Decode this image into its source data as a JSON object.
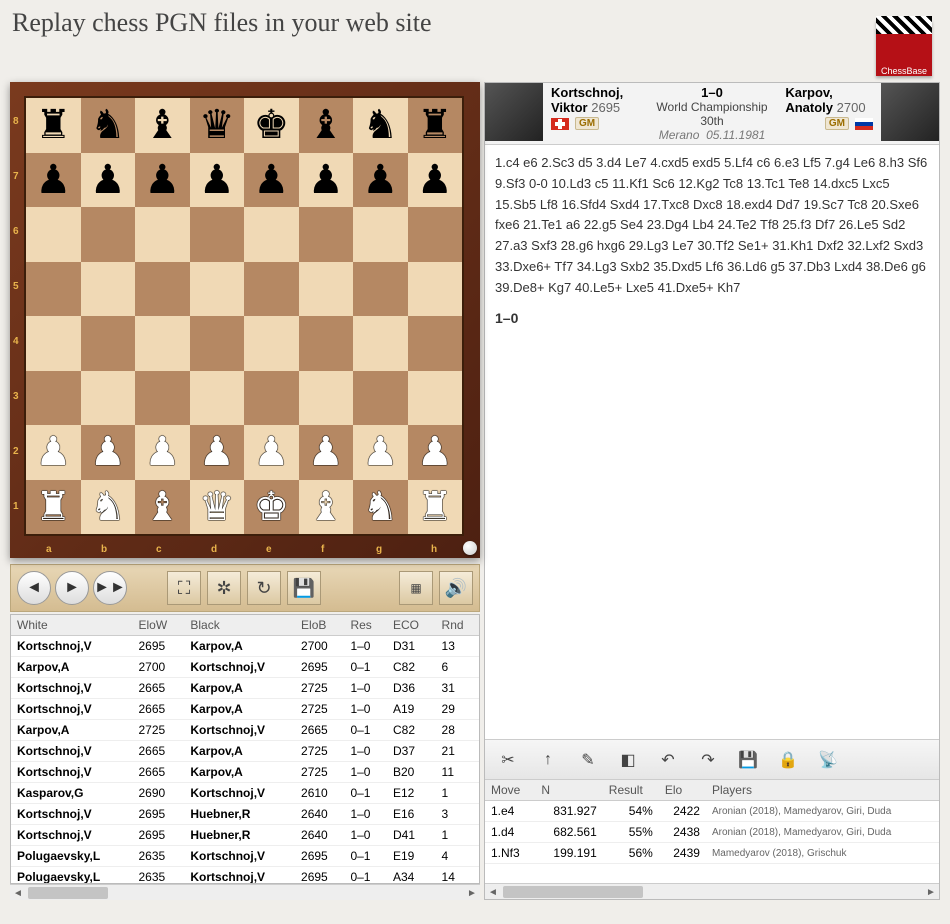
{
  "title": "Replay chess PGN files in your web site",
  "logo_label": "ChessBase",
  "header": {
    "white": {
      "name": "Kortschnoj, Viktor",
      "elo": "2695",
      "title": "GM",
      "flag": "ch"
    },
    "black": {
      "name": "Karpov, Anatoly",
      "elo": "2700",
      "title": "GM",
      "flag": "ru"
    },
    "result": "1–0",
    "event": "World Championship 30th",
    "location": "Merano",
    "date": "05.11.1981"
  },
  "notation": "1.c4 e6 2.Sc3 d5 3.d4 Le7 4.cxd5 exd5 5.Lf4 c6 6.e3 Lf5 7.g4 Le6 8.h3 Sf6 9.Sf3 0-0 10.Ld3 c5 11.Kf1 Sc6 12.Kg2 Tc8 13.Tc1 Te8 14.dxc5 Lxc5 15.Sb5 Lf8 16.Sfd4 Sxd4 17.Txc8 Dxc8 18.exd4 Dd7 19.Sc7 Tc8 20.Sxe6 fxe6 21.Te1 a6 22.g5 Se4 23.Dg4 Lb4 24.Te2 Tf8 25.f3 Df7 26.Le5 Sd2 27.a3 Sxf3 28.g6 hxg6 29.Lg3 Le7 30.Tf2 Se1+ 31.Kh1 Dxf2 32.Lxf2 Sxd3 33.Dxe6+ Tf7 34.Lg3 Sxb2 35.Dxd5 Lf6 36.Ld6 g5 37.Db3 Lxd4 38.De6 g6 39.De8+ Kg7 40.Le5+ Lxe5 41.Dxe5+ Kh7",
  "result_line": "1–0",
  "board": {
    "ranks": [
      "8",
      "7",
      "6",
      "5",
      "4",
      "3",
      "2",
      "1"
    ],
    "files": [
      "a",
      "b",
      "c",
      "d",
      "e",
      "f",
      "g",
      "h"
    ],
    "pieces": [
      [
        "br",
        "bn",
        "bb",
        "bq",
        "bk",
        "bb",
        "bn",
        "br"
      ],
      [
        "bp",
        "bp",
        "bp",
        "bp",
        "bp",
        "bp",
        "bp",
        "bp"
      ],
      [
        "",
        "",
        "",
        "",
        "",
        "",
        "",
        ""
      ],
      [
        "",
        "",
        "",
        "",
        "",
        "",
        "",
        ""
      ],
      [
        "",
        "",
        "",
        "",
        "",
        "",
        "",
        ""
      ],
      [
        "",
        "",
        "",
        "",
        "",
        "",
        "",
        ""
      ],
      [
        "wp",
        "wp",
        "wp",
        "wp",
        "wp",
        "wp",
        "wp",
        "wp"
      ],
      [
        "wr",
        "wn",
        "wb",
        "wq",
        "wk",
        "wb",
        "wn",
        "wr"
      ]
    ]
  },
  "games_columns": [
    "White",
    "EloW",
    "Black",
    "EloB",
    "Res",
    "ECO",
    "Rnd"
  ],
  "games": [
    {
      "w": "Kortschnoj,V",
      "ew": "2695",
      "b": "Karpov,A",
      "eb": "2700",
      "r": "1–0",
      "eco": "D31",
      "rnd": "13"
    },
    {
      "w": "Karpov,A",
      "ew": "2700",
      "b": "Kortschnoj,V",
      "eb": "2695",
      "r": "0–1",
      "eco": "C82",
      "rnd": "6"
    },
    {
      "w": "Kortschnoj,V",
      "ew": "2665",
      "b": "Karpov,A",
      "eb": "2725",
      "r": "1–0",
      "eco": "D36",
      "rnd": "31"
    },
    {
      "w": "Kortschnoj,V",
      "ew": "2665",
      "b": "Karpov,A",
      "eb": "2725",
      "r": "1–0",
      "eco": "A19",
      "rnd": "29"
    },
    {
      "w": "Karpov,A",
      "ew": "2725",
      "b": "Kortschnoj,V",
      "eb": "2665",
      "r": "0–1",
      "eco": "C82",
      "rnd": "28"
    },
    {
      "w": "Kortschnoj,V",
      "ew": "2665",
      "b": "Karpov,A",
      "eb": "2725",
      "r": "1–0",
      "eco": "D37",
      "rnd": "21"
    },
    {
      "w": "Kortschnoj,V",
      "ew": "2665",
      "b": "Karpov,A",
      "eb": "2725",
      "r": "1–0",
      "eco": "B20",
      "rnd": "11"
    },
    {
      "w": "Kasparov,G",
      "ew": "2690",
      "b": "Kortschnoj,V",
      "eb": "2610",
      "r": "0–1",
      "eco": "E12",
      "rnd": "1"
    },
    {
      "w": "Kortschnoj,V",
      "ew": "2695",
      "b": "Huebner,R",
      "eb": "2640",
      "r": "1–0",
      "eco": "E16",
      "rnd": "3"
    },
    {
      "w": "Kortschnoj,V",
      "ew": "2695",
      "b": "Huebner,R",
      "eb": "2640",
      "r": "1–0",
      "eco": "D41",
      "rnd": "1"
    },
    {
      "w": "Polugaevsky,L",
      "ew": "2635",
      "b": "Kortschnoj,V",
      "eb": "2695",
      "r": "0–1",
      "eco": "E19",
      "rnd": "4"
    },
    {
      "w": "Polugaevsky,L",
      "ew": "2635",
      "b": "Kortschnoj,V",
      "eb": "2695",
      "r": "0–1",
      "eco": "A34",
      "rnd": "14"
    }
  ],
  "engine_columns": [
    "Move",
    "N",
    "Result",
    "Elo",
    "Players"
  ],
  "engine": [
    {
      "m": "1.e4",
      "n": "831.927",
      "r": "54%",
      "e": "2422",
      "p": "Aronian (2018), Mamedyarov, Giri, Duda"
    },
    {
      "m": "1.d4",
      "n": "682.561",
      "r": "55%",
      "e": "2438",
      "p": "Aronian (2018), Mamedyarov, Giri, Duda"
    },
    {
      "m": "1.Nf3",
      "n": "199.191",
      "r": "56%",
      "e": "2439",
      "p": "Mamedyarov (2018), Grischuk"
    }
  ]
}
